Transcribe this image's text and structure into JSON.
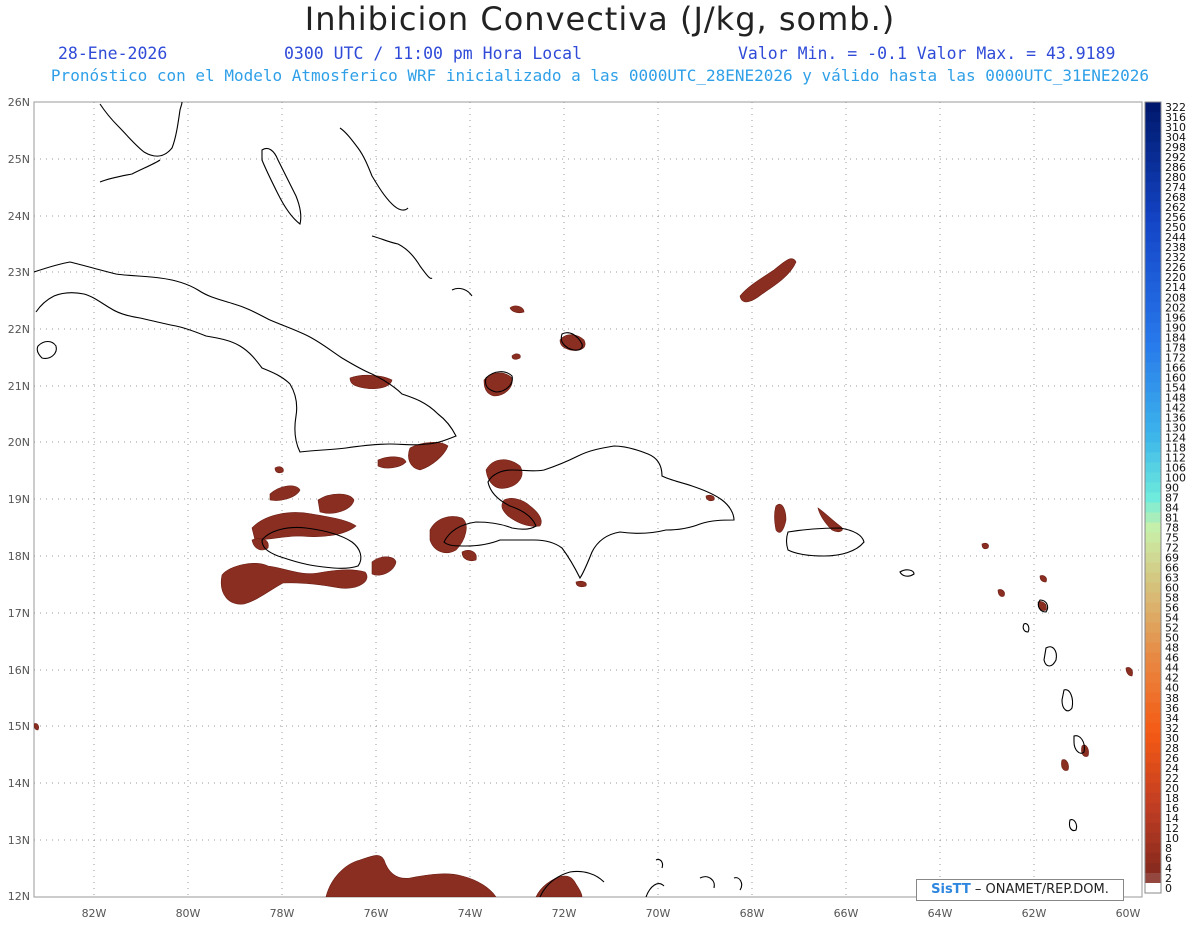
{
  "header": {
    "title": "Inhibicion Convectiva (J/kg, somb.)",
    "date": "28-Ene-2026",
    "time": "0300 UTC / 11:00 pm Hora Local",
    "minmax": "Valor Min. = -0.1  Valor Max. = 43.9189",
    "info": "Pronóstico con el Modelo Atmosferico WRF inicializado a las 0000UTC_28ENE2026 y válido hasta las  0000UTC_31ENE2026"
  },
  "map": {
    "lat_labels": [
      "26N",
      "25N",
      "24N",
      "23N",
      "22N",
      "21N",
      "20N",
      "19N",
      "18N",
      "17N",
      "16N",
      "15N",
      "14N",
      "13N",
      "12N"
    ],
    "lon_labels": [
      "82W",
      "80W",
      "78W",
      "76W",
      "74W",
      "72W",
      "70W",
      "68W",
      "66W",
      "64W",
      "62W",
      "60W"
    ],
    "lat_range": [
      12,
      26
    ],
    "lon_range": [
      -83.2,
      -60
    ],
    "grid": true,
    "fill_color": "#8b2e22",
    "coast_color": "#000000"
  },
  "colorbar": {
    "labels": [
      "322",
      "316",
      "310",
      "304",
      "298",
      "292",
      "286",
      "280",
      "274",
      "268",
      "262",
      "256",
      "250",
      "244",
      "238",
      "232",
      "226",
      "220",
      "214",
      "208",
      "202",
      "196",
      "190",
      "184",
      "178",
      "172",
      "166",
      "160",
      "154",
      "148",
      "142",
      "136",
      "130",
      "124",
      "118",
      "112",
      "106",
      "100",
      "90",
      "87",
      "84",
      "81",
      "78",
      "75",
      "72",
      "69",
      "66",
      "63",
      "60",
      "58",
      "56",
      "54",
      "52",
      "50",
      "48",
      "46",
      "44",
      "42",
      "40",
      "38",
      "36",
      "34",
      "32",
      "30",
      "28",
      "26",
      "24",
      "22",
      "20",
      "18",
      "16",
      "14",
      "12",
      "10",
      "8",
      "6",
      "4",
      "2",
      "0"
    ]
  },
  "credit": {
    "brand": "SisTT",
    "text": " – ONAMET/REP.DOM."
  }
}
